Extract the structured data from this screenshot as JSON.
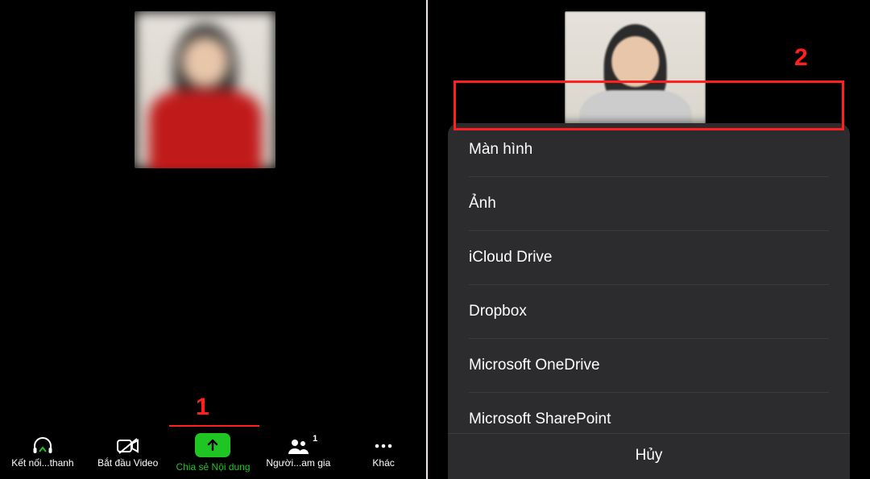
{
  "annotations": {
    "step1": "1",
    "step2": "2"
  },
  "toolbar": {
    "audio_label": "Kết nối...thanh",
    "video_label": "Bắt đầu Video",
    "share_label": "Chia sẻ Nội dung",
    "participants_label": "Người...am gia",
    "participants_count": "1",
    "more_label": "Khác"
  },
  "share_sheet": {
    "items": [
      "Màn hình",
      "Ảnh",
      "iCloud Drive",
      "Dropbox",
      "Microsoft OneDrive",
      "Microsoft SharePoint"
    ],
    "cancel": "Hủy"
  },
  "colors": {
    "highlight": "#ff1f1f",
    "share_green": "#1fc523",
    "sheet_bg": "#2c2c2e"
  }
}
